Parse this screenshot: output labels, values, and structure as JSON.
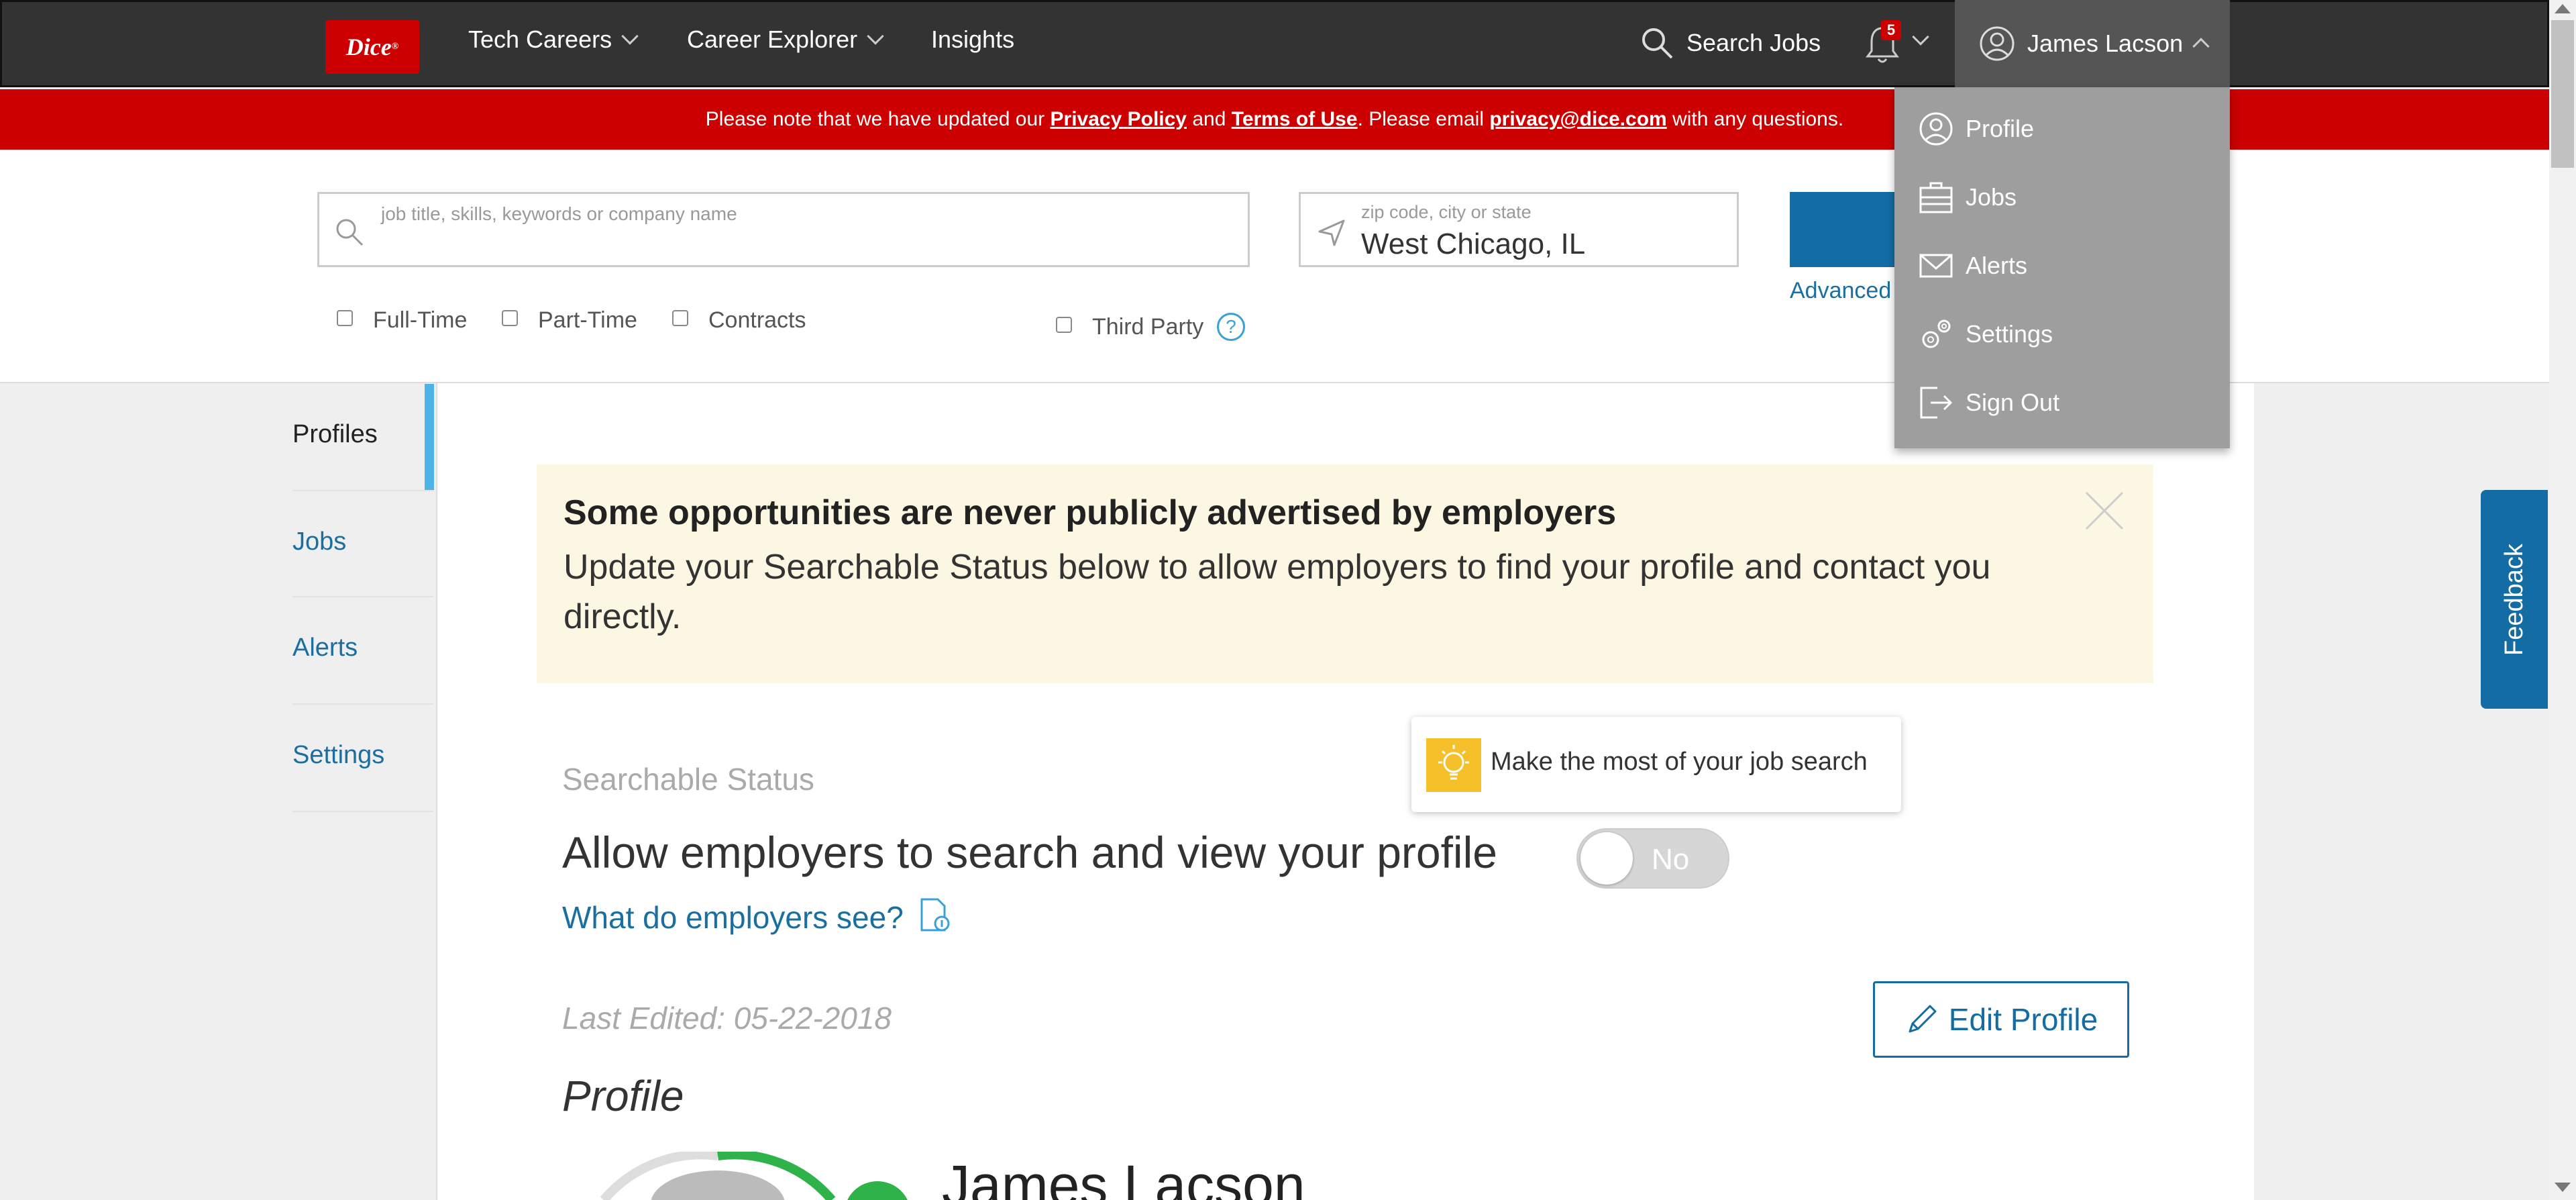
{
  "nav": {
    "logo": "Dice",
    "items": [
      {
        "label": "Tech Careers"
      },
      {
        "label": "Career Explorer"
      },
      {
        "label": "Insights"
      }
    ],
    "search_jobs": "Search Jobs",
    "notification_count": "5",
    "user_name": "James Lacson"
  },
  "notice": {
    "prefix": "Please note that we have updated our ",
    "privacy": "Privacy Policy",
    "and": " and ",
    "terms": "Terms of Use",
    "middle": ". Please email ",
    "email": "privacy@dice.com",
    "suffix": " with any questions."
  },
  "search": {
    "keyword_placeholder": "job title, skills, keywords or company name",
    "location_placeholder": "zip code, city or state",
    "location_value": "West Chicago, IL",
    "advanced_link": "Advanced",
    "filters": [
      "Full-Time",
      "Part-Time",
      "Contracts"
    ],
    "third_party": "Third Party"
  },
  "sidebar": {
    "items": [
      "Profiles",
      "Jobs",
      "Alerts",
      "Settings"
    ]
  },
  "promo": {
    "heading": "Some opportunities are never publicly advertised by employers",
    "body": "Update your Searchable Status below to allow employers to find your profile and contact you directly."
  },
  "tip": {
    "label": "Make the most of your job search"
  },
  "status": {
    "heading": "Searchable Status",
    "allow_label": "Allow employers to search and view your profile",
    "toggle_value": "No",
    "employers_link": "What do employers see?"
  },
  "profile": {
    "last_edited": "Last Edited: 05-22-2018",
    "edit_button": "Edit Profile",
    "section_title": "Profile",
    "name": "James Lacson"
  },
  "dropdown": {
    "items": [
      "Profile",
      "Jobs",
      "Alerts",
      "Settings",
      "Sign Out"
    ]
  },
  "feedback": "Feedback",
  "colors": {
    "nav_bg": "#333333",
    "brand_red": "#cc0000",
    "link_blue": "#1a6fa0",
    "accent_blue": "#136ca4",
    "promo_bg": "#fcf7e2",
    "dropdown_bg": "#9e9e9e",
    "active_tab": "#4db3e6",
    "tip_yellow": "#f6c02a",
    "progress_green": "#2fb24a"
  }
}
